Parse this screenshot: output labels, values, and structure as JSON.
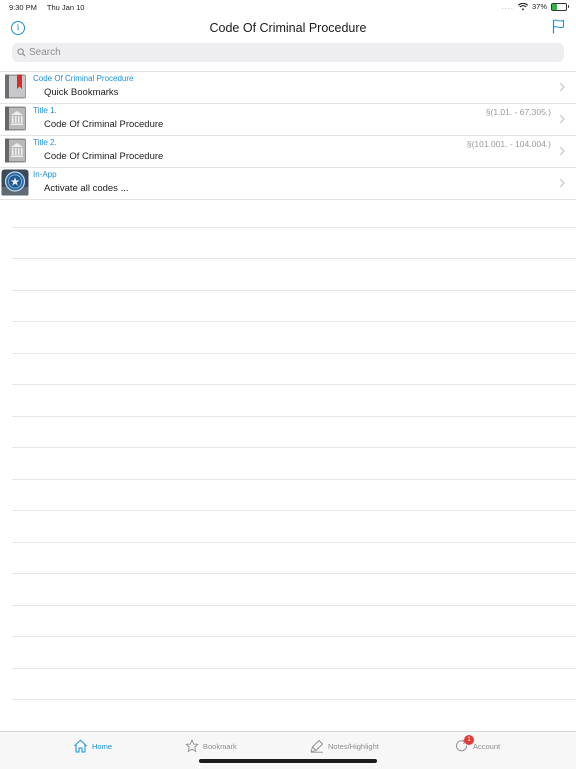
{
  "status_bar": {
    "time": "9:30 PM",
    "date": "Thu Jan 10",
    "signal_dots": "....",
    "battery_percent": "37%",
    "battery_level": 0.37
  },
  "nav": {
    "title": "Code Of Criminal Procedure",
    "left_icon": "info-icon",
    "right_icon": "flag-icon",
    "accent_color": "#1a8fd8"
  },
  "search": {
    "placeholder": "Search",
    "value": ""
  },
  "list": {
    "rows": [
      {
        "icon": "bookmark-book-icon",
        "title": "Code Of Criminal Procedure",
        "subtitle": "Quick Bookmarks",
        "range": ""
      },
      {
        "icon": "courthouse-book-icon",
        "title": "Title 1.",
        "subtitle": "Code Of Criminal Procedure",
        "range": "§(1.01. - 67.305.)"
      },
      {
        "icon": "courthouse-book-icon",
        "title": "Title 2.",
        "subtitle": "Code Of Criminal Procedure",
        "range": "§(101.001. - 104.004.)"
      },
      {
        "icon": "in-app-seal-icon",
        "title": "In-App",
        "subtitle": "Activate all codes ...",
        "range": ""
      }
    ]
  },
  "tab_bar": {
    "tabs": [
      {
        "label": "Home",
        "icon": "home-icon",
        "active": true
      },
      {
        "label": "Bookmark",
        "icon": "star-icon",
        "active": false
      },
      {
        "label": "Notes/Highlight",
        "icon": "highlighter-icon",
        "active": false
      },
      {
        "label": "Account",
        "icon": "refresh-icon",
        "active": false,
        "badge": "1"
      }
    ]
  }
}
